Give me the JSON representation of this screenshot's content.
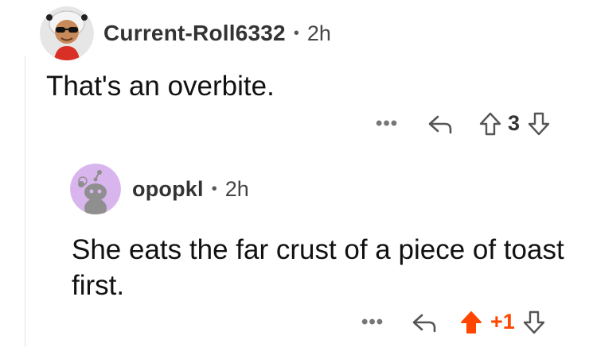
{
  "comments": [
    {
      "username": "Current-Roll6332",
      "separator": "•",
      "time": "2h",
      "body": "That's an overbite.",
      "more_label": "•••",
      "vote_count": "3",
      "upvoted": false
    },
    {
      "username": "opopkl",
      "separator": "•",
      "time": "2h",
      "body": "She eats the far crust of a piece of toast first.",
      "more_label": "•••",
      "vote_count": "+1",
      "upvoted": true
    }
  ],
  "colors": {
    "upvote_active": "#ff4500",
    "avatar_2_bg": "#d9b5ee",
    "icon_gray": "#555555",
    "thread_line": "#e5e5e5"
  },
  "icons": {
    "reply": "reply-arrow-icon",
    "upvote": "upvote-arrow-icon",
    "downvote": "downvote-arrow-icon"
  }
}
